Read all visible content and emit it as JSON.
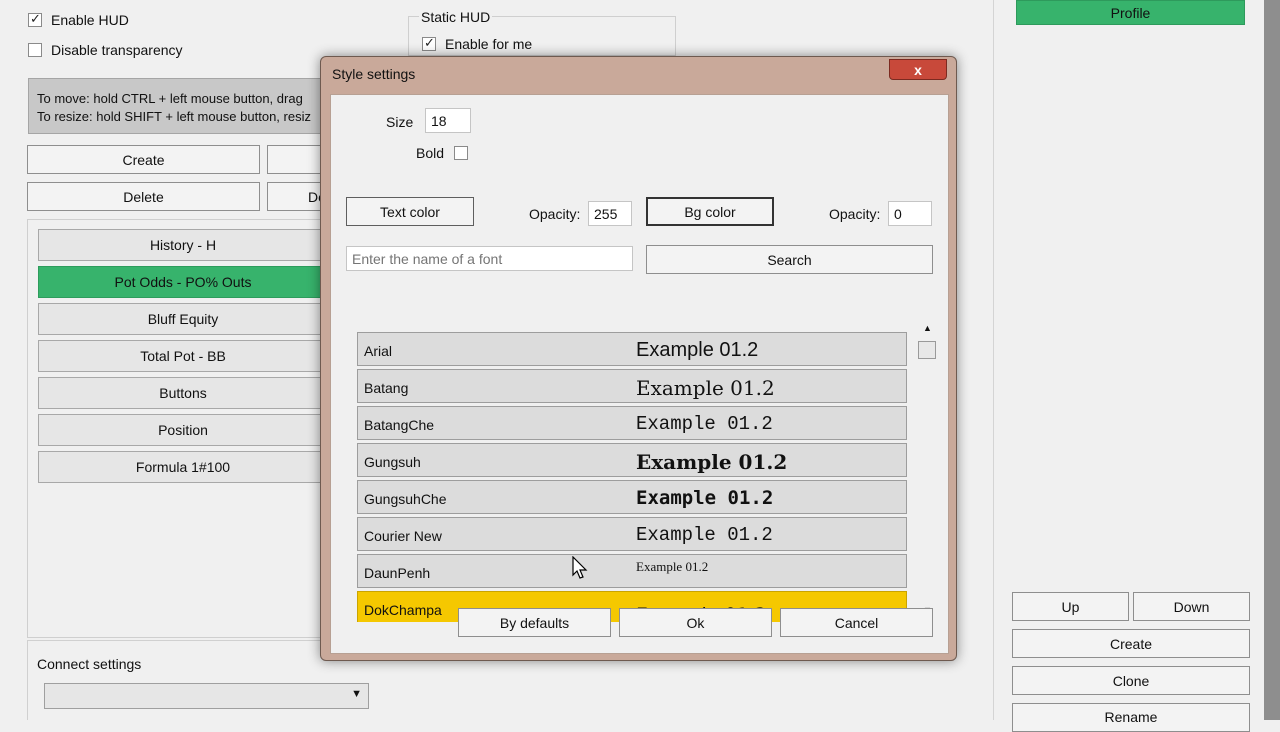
{
  "main": {
    "enable_hud_label": "Enable HUD",
    "enable_hud_checked": true,
    "disable_transparency_label": "Disable transparency",
    "disable_transparency_checked": false,
    "static_hud_title": "Static HUD",
    "enable_for_me_label": "Enable for me",
    "enable_for_me_checked": true,
    "help_line1": "To move: hold CTRL + left mouse button, drag",
    "help_line2": "To resize: hold SHIFT + left mouse button, resiz",
    "create_label": "Create",
    "delete_label": "Delete",
    "delete_partial_label": "De",
    "stats": [
      {
        "label": "History - H",
        "active": false
      },
      {
        "label": "Pot Odds - PO% Outs",
        "active": true
      },
      {
        "label": "Bluff Equity",
        "active": false
      },
      {
        "label": "Total Pot - BB",
        "active": false
      },
      {
        "label": "Buttons",
        "active": false
      },
      {
        "label": "Position",
        "active": false
      },
      {
        "label": "Formula 1#100",
        "active": false
      }
    ],
    "connect_settings_label": "Connect settings",
    "connect_settings_value": ""
  },
  "right_panel": {
    "profile_label": "Profile",
    "up_label": "Up",
    "down_label": "Down",
    "create_label": "Create",
    "clone_label": "Clone",
    "rename_label": "Rename",
    "accent_color": "#37b36c"
  },
  "dialog": {
    "title": "Style settings",
    "close_label": "x",
    "size_label": "Size",
    "size_value": "18",
    "bold_label": "Bold",
    "bold_checked": false,
    "text_color_label": "Text color",
    "opacity_label": "Opacity:",
    "text_opacity_value": "255",
    "bg_color_label": "Bg color",
    "bg_opacity_value": "0",
    "search_placeholder": "Enter the name of a font",
    "search_label": "Search",
    "fonts": [
      {
        "name": "Arial",
        "example": "Example 01.2",
        "selected": false
      },
      {
        "name": "Batang",
        "example": "Example 01.2",
        "selected": false
      },
      {
        "name": "BatangChe",
        "example": "Example 01.2",
        "selected": false
      },
      {
        "name": "Gungsuh",
        "example": "Example 01.2",
        "selected": false
      },
      {
        "name": "GungsuhChe",
        "example": "Example 01.2",
        "selected": false
      },
      {
        "name": "Courier New",
        "example": "Example 01.2",
        "selected": false
      },
      {
        "name": "DaunPenh",
        "example": "Example 01.2",
        "selected": false
      },
      {
        "name": "DokChampa",
        "example": "Example 01.2",
        "selected": true
      }
    ],
    "selected_color": "#f5c800",
    "by_defaults_label": "By defaults",
    "ok_label": "Ok",
    "cancel_label": "Cancel"
  }
}
